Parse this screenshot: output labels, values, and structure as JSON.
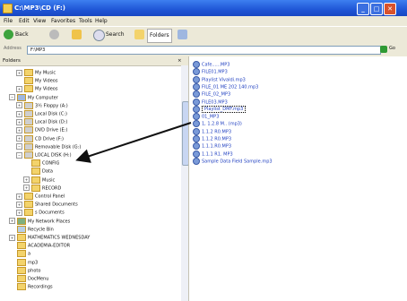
{
  "window": {
    "title": "C:\\MP3\\CD (F:)"
  },
  "menu": [
    "File",
    "Edit",
    "View",
    "Favorites",
    "Tools",
    "Help"
  ],
  "toolbar": {
    "back": "Back",
    "search": "Search",
    "folders": "Folders"
  },
  "address": {
    "label": "Address",
    "value": "F:\\MP3",
    "go": "Go"
  },
  "folders_pane": {
    "title": "Folders",
    "close": "×"
  },
  "tree": [
    {
      "label": "My Music",
      "expander": "+",
      "indent": 1,
      "icon": "folder"
    },
    {
      "label": "My Videos",
      "expander": "",
      "indent": 1,
      "icon": "folder"
    },
    {
      "label": "My Videos",
      "expander": "+",
      "indent": 1,
      "icon": "folder"
    },
    {
      "label": "My Computer",
      "expander": "−",
      "indent": 0,
      "icon": "computer"
    },
    {
      "label": "3½ Floppy (A:)",
      "expander": "+",
      "indent": 1,
      "icon": "drive"
    },
    {
      "label": "Local Disk (C:)",
      "expander": "+",
      "indent": 1,
      "icon": "drive"
    },
    {
      "label": "Local Disk (D:)",
      "expander": "+",
      "indent": 1,
      "icon": "drive"
    },
    {
      "label": "DVD Drive (E:)",
      "expander": "+",
      "indent": 1,
      "icon": "drive"
    },
    {
      "label": "CD Drive (F:)",
      "expander": "+",
      "indent": 1,
      "icon": "drive"
    },
    {
      "label": "Removable Disk (G:)",
      "expander": "−",
      "indent": 1,
      "icon": "drive"
    },
    {
      "label": "LOCAL DISK (H:)",
      "expander": "−",
      "indent": 1,
      "icon": "drive"
    },
    {
      "label": "CONFIG",
      "expander": "",
      "indent": 2,
      "icon": "folder"
    },
    {
      "label": "Data",
      "expander": "",
      "indent": 2,
      "icon": "folder"
    },
    {
      "label": "Music",
      "expander": "+",
      "indent": 2,
      "icon": "folder"
    },
    {
      "label": "RECORD",
      "expander": "+",
      "indent": 2,
      "icon": "folder"
    },
    {
      "label": "Control Panel",
      "expander": "+",
      "indent": 1,
      "icon": "folder"
    },
    {
      "label": "Shared Documents",
      "expander": "+",
      "indent": 1,
      "icon": "folder"
    },
    {
      "label": "s Documents",
      "expander": "+",
      "indent": 1,
      "icon": "folder"
    },
    {
      "label": "My Network Places",
      "expander": "+",
      "indent": 0,
      "icon": "network"
    },
    {
      "label": "Recycle Bin",
      "expander": "",
      "indent": 0,
      "icon": "recycle"
    },
    {
      "label": "MATHEMATICS WEDNESDAY",
      "expander": "+",
      "indent": 0,
      "icon": "folder"
    },
    {
      "label": "ACADEMIA-EDITOR",
      "expander": "",
      "indent": 0,
      "icon": "folder"
    },
    {
      "label": "a",
      "expander": "",
      "indent": 0,
      "icon": "folder"
    },
    {
      "label": "mp3",
      "expander": "",
      "indent": 0,
      "icon": "folder"
    },
    {
      "label": "photo",
      "expander": "",
      "indent": 0,
      "icon": "folder"
    },
    {
      "label": "DocMenu",
      "expander": "",
      "indent": 0,
      "icon": "folder"
    },
    {
      "label": "Recordings",
      "expander": "",
      "indent": 0,
      "icon": "folder"
    }
  ],
  "files": [
    {
      "name": "Cafe......MP3",
      "selected": false
    },
    {
      "name": "FILE01.MP3",
      "selected": false
    },
    {
      "name": "Playlist Vivaldi.mp3",
      "selected": false
    },
    {
      "name": "FILE_01 ME 202 140.mp3",
      "selected": false
    },
    {
      "name": "FILE_02_MP3",
      "selected": false
    },
    {
      "name": "FILE03.MP3",
      "selected": false
    },
    {
      "name": "Playlist_DMF.mp3",
      "selected": true
    },
    {
      "name": "01_MP3",
      "selected": false
    },
    {
      "name": "1, 1.2.8 M.. (mp3)",
      "selected": false
    },
    {
      "name": "1.1.2 R0.MP3",
      "selected": false
    },
    {
      "name": "1.1.2 R0.MP3",
      "selected": false
    },
    {
      "name": "1.1.1.R0.MP3",
      "selected": false
    },
    {
      "name": "1.1.1 R1. MP3",
      "selected": false
    },
    {
      "name": "Sample Data Field Sample.mp3",
      "selected": false
    }
  ],
  "colors": {
    "titlebar": "#1f56d6",
    "link": "#1e3ec0",
    "arrow": "#111111"
  }
}
